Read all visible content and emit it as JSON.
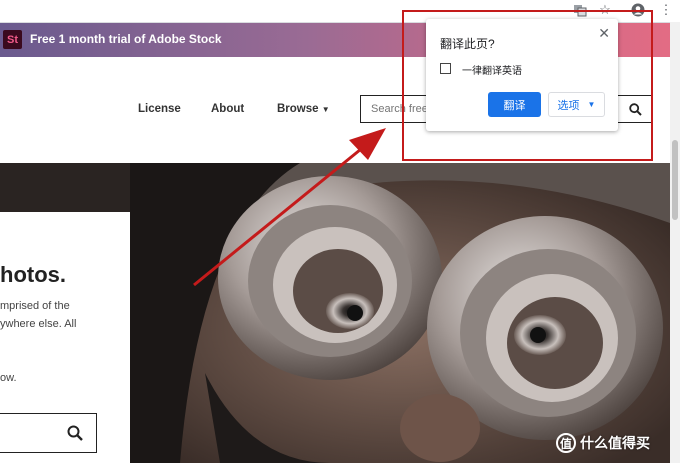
{
  "banner": {
    "logo": "St",
    "text": "Free 1 month trial of Adobe Stock"
  },
  "nav": {
    "license": "License",
    "about": "About",
    "browse": "Browse",
    "search_placeholder": "Search free"
  },
  "card": {
    "title": "hotos.",
    "lines": [
      "mprised of the",
      "ywhere else. All",
      "ow."
    ]
  },
  "popup": {
    "title": "翻译此页?",
    "checkbox_label": "一律翻译英语",
    "translate_button": "翻译",
    "options_button": "选项"
  },
  "watermark": {
    "icon": "值",
    "text": "什么值得买"
  },
  "colors": {
    "accent_blue": "#1a73e8",
    "annotation_red": "#c41b1b"
  }
}
